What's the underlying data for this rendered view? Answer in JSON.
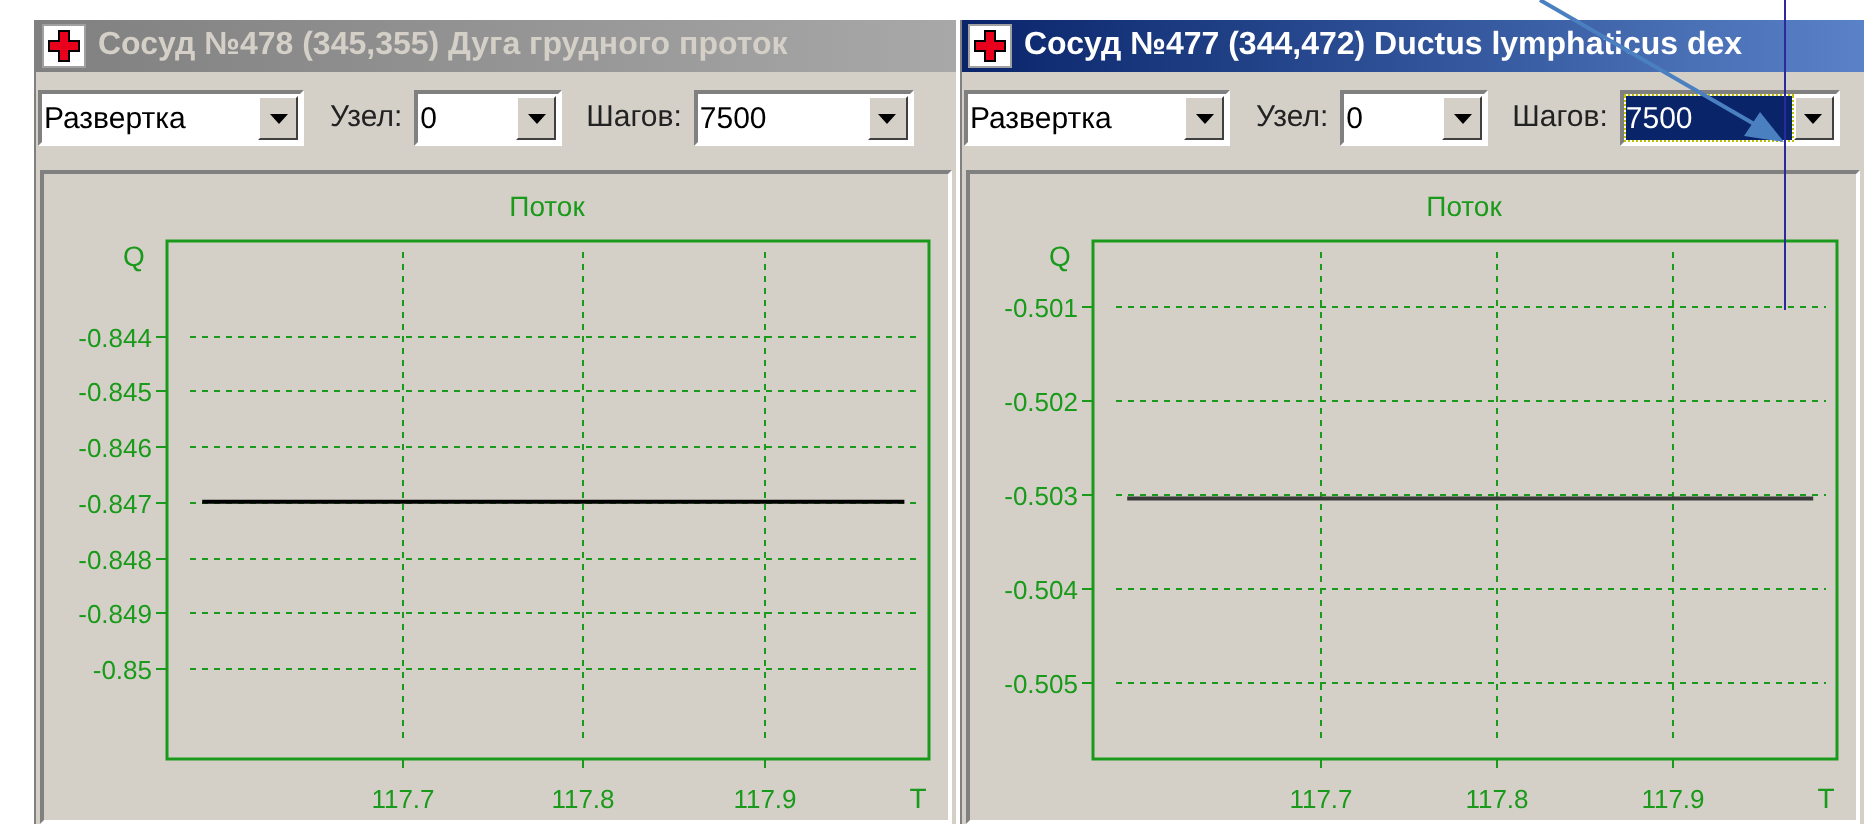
{
  "windows": [
    {
      "title": "Сосуд №478 (345,355) Дуга грудного проток",
      "active": false,
      "mode": "Развертка",
      "node_label": "Узел:",
      "node": "0",
      "steps_label": "Шагов:",
      "steps": "7500",
      "steps_highlighted": false,
      "chart_data": {
        "type": "line",
        "grid": true,
        "title": "Поток",
        "xlabel": "T",
        "ylabel": "Q",
        "xlim": [
          117.57,
          117.991
        ],
        "ylim": [
          -0.85161,
          -0.84229
        ],
        "xticks": [
          117.7,
          117.8,
          117.9
        ],
        "yticks": [
          -0.844,
          -0.845,
          -0.846,
          -0.847,
          -0.848,
          -0.849,
          -0.85
        ],
        "x": [
          117.59,
          117.978
        ],
        "series": [
          {
            "color": "#000000",
            "values": [
              -0.847,
              -0.847
            ]
          }
        ]
      }
    },
    {
      "title": "Сосуд №477 (344,472) Ductus lymphaticus dex",
      "active": true,
      "mode": "Развертка",
      "node_label": "Узел:",
      "node": "0",
      "steps_label": "Шагов:",
      "steps": "7500",
      "steps_highlighted": true,
      "chart_data": {
        "type": "line",
        "grid": true,
        "title": "Поток",
        "xlabel": "T",
        "ylabel": "Q",
        "xlim": [
          117.57,
          117.993
        ],
        "ylim": [
          -0.50581,
          -0.5003
        ],
        "xticks": [
          117.7,
          117.8,
          117.9
        ],
        "yticks": [
          -0.501,
          -0.502,
          -0.503,
          -0.504,
          -0.505
        ],
        "x": [
          117.59,
          117.98
        ],
        "series": [
          {
            "color": "#3a3a3a",
            "values": [
              -0.50305,
              -0.50305
            ]
          }
        ]
      }
    }
  ]
}
